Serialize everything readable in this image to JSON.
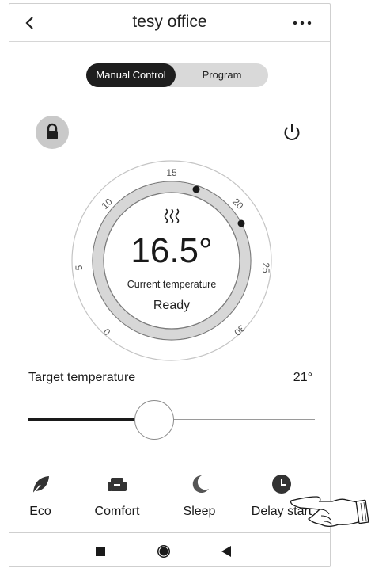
{
  "header": {
    "title": "tesy office",
    "back_icon": "chevron-left-icon",
    "more_icon": "more-icon"
  },
  "control_mode": {
    "options": [
      "Manual Control",
      "Program"
    ],
    "selected": "Manual Control"
  },
  "dial": {
    "scale_labels": [
      "0",
      "5",
      "10",
      "15",
      "20",
      "25",
      "30"
    ],
    "heating_icon": "heat-waves-icon",
    "current_temperature": "16.5°",
    "current_label": "Current temperature",
    "status": "Ready"
  },
  "target": {
    "label": "Target temperature",
    "value": "21°",
    "slider_level_fraction": 0.44
  },
  "modes": [
    {
      "label": "Eco",
      "icon": "leaf-icon"
    },
    {
      "label": "Comfort",
      "icon": "sofa-icon"
    },
    {
      "label": "Sleep",
      "icon": "moon-icon"
    },
    {
      "label": "Delay start",
      "icon": "clock-icon"
    }
  ],
  "colors": {
    "active_segment": "#1e1e1e",
    "segment_bg": "#d9d9d9",
    "ring": "#d7d7d7",
    "lock_bg": "#c9c9c9"
  }
}
